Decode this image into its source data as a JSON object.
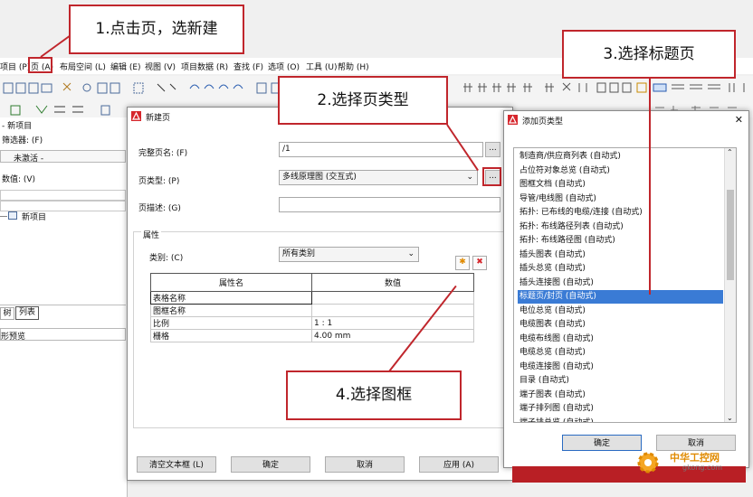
{
  "menu": [
    "项目 (P)",
    "页 (A)",
    "布局空间 (L)",
    "编辑 (E)",
    "视图 (V)",
    "项目数据 (R)",
    "查找 (F)",
    "选项 (O)",
    "工具 (U)",
    "帮助 (H)"
  ],
  "left_panel": {
    "title": "- 新项目",
    "filter_label": "筛选器: (F)",
    "inactive": "未激活 -",
    "value_label": "数值: (V)",
    "tree_item": "新项目",
    "tabs": [
      "树",
      "列表"
    ],
    "preview": "形预览"
  },
  "new_page_dialog": {
    "title": "新建页",
    "full_name_label": "完整页名: (F)",
    "full_name_value": "/1",
    "page_type_label": "页类型: (P)",
    "page_type_value": "多线原理图 (交互式)",
    "desc_label": "页描述: (G)",
    "desc_value": "",
    "attributes_group": "属性",
    "category_label": "类别: (C)",
    "category_value": "所有类别",
    "table": {
      "headers": [
        "属性名",
        "数值"
      ],
      "rows": [
        [
          "表格名称",
          ""
        ],
        [
          "图框名称",
          ""
        ],
        [
          "比例",
          "1 : 1"
        ],
        [
          "栅格",
          "4.00 mm"
        ]
      ]
    },
    "buttons": {
      "clear": "清空文本框 (L)",
      "ok": "确定",
      "cancel": "取消",
      "apply": "应用 (A)"
    },
    "ellipsis": "..."
  },
  "add_page_type_dialog": {
    "title": "添加页类型",
    "items": [
      "制造商/供应商列表 (自动式)",
      "占位符对象总览 (自动式)",
      "图框文档 (自动式)",
      "导管/电线图 (自动式)",
      "拓扑: 已布线的电缆/连接 (自动式)",
      "拓扑: 布线路径列表 (自动式)",
      "拓扑: 布线路径图 (自动式)",
      "插头图表 (自动式)",
      "插头总览 (自动式)",
      "插头连接图 (自动式)",
      "标题页/封页 (自动式)",
      "电位总览 (自动式)",
      "电缆图表 (自动式)",
      "电缆布线图 (自动式)",
      "电缆总览 (自动式)",
      "电缆连接图 (自动式)",
      "目录 (自动式)",
      "端子图表 (自动式)",
      "端子排列图 (自动式)",
      "端子排总览 (自动式)"
    ],
    "selected_index": 10,
    "buttons": {
      "ok": "确定",
      "cancel": "取消"
    },
    "close": "✕"
  },
  "annotations": {
    "step1": "1.点击页，选新建",
    "step2": "2.选择页类型",
    "step3": "3.选择标题页",
    "step4": "4.选择图框"
  },
  "watermark": {
    "name": "中华工控网",
    "url": "gkong.com"
  },
  "colors": {
    "accent_red": "#c0262c",
    "selection_blue": "#3a7bd5"
  }
}
